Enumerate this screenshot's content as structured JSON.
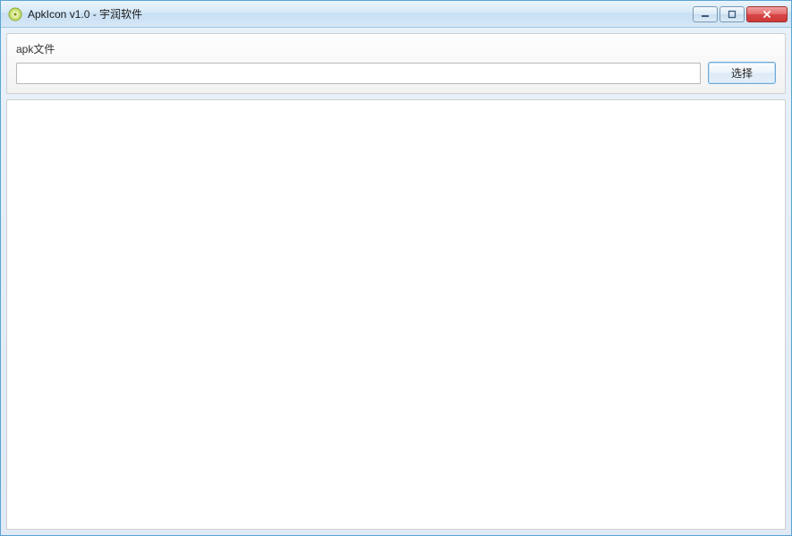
{
  "window": {
    "title": "ApkIcon v1.0 - 宇润软件"
  },
  "panel": {
    "label": "apk文件",
    "file_value": "",
    "select_button": "选择"
  }
}
